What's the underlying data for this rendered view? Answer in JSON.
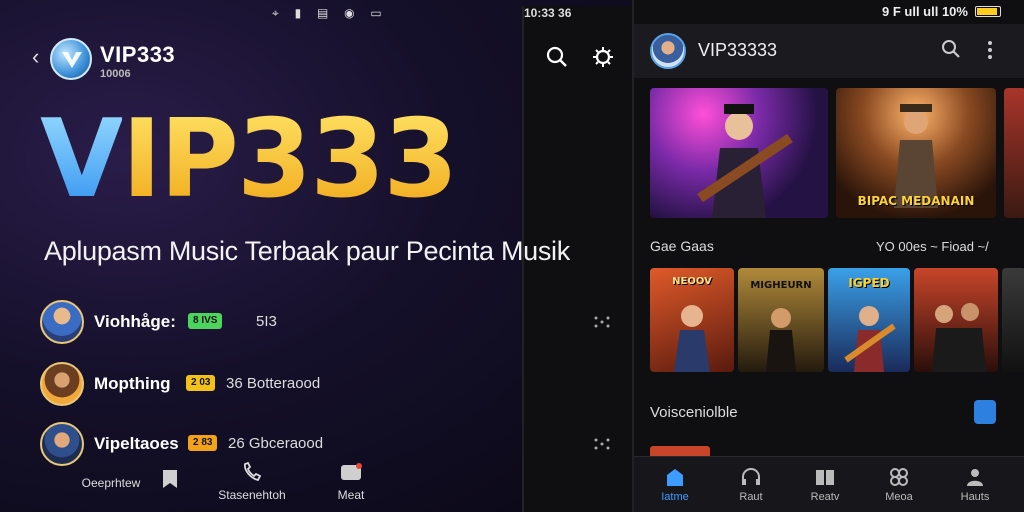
{
  "left": {
    "status": {
      "icons": "⌖ ▮ ▤ ◉ ▭",
      "right": "10:33 36"
    },
    "header": {
      "app_name": "VIP333",
      "app_sub": "10006"
    },
    "brand": {
      "v": "V",
      "rest": "IP333"
    },
    "tagline": "Aplupasm Music Terbaak paur Pecinta Musik",
    "users": [
      {
        "name": "Viohhåge:",
        "badge": "8 IVS",
        "badge_color": "#4cd45c",
        "meta": "5I3"
      },
      {
        "name": "Mopthing",
        "badge": "2 03",
        "badge_color": "#f2c21a",
        "meta": "36 Botteraood"
      },
      {
        "name": "Vipeltaoes",
        "badge": "2 83",
        "badge_color": "#f2a31a",
        "meta": "26 Gbceraood"
      }
    ],
    "bottom_nav": [
      {
        "label": "Oeeprhtew",
        "icon": "bookmark-icon"
      },
      {
        "label": "Stasenehtoh",
        "icon": "phone-icon"
      },
      {
        "label": "Meat",
        "icon": "chat-icon"
      }
    ]
  },
  "right": {
    "status": "9 F ull ull 10%",
    "topbar": {
      "title": "VIP33333"
    },
    "featured": [
      {
        "caption": "",
        "accent": "#c83fd0"
      },
      {
        "caption": "BIPAC MEDANAIN",
        "accent": "#d98a2c"
      }
    ],
    "section1": {
      "title": "Gae Gaas",
      "right": "YO 00es ~ Fioad ~/"
    },
    "grid": [
      {
        "caption": "NEOOV",
        "accent": "#e05a2a"
      },
      {
        "caption": "MIGHEURN",
        "accent": "#d9b54a"
      },
      {
        "caption": "IGPED",
        "accent": "#3aa0e8"
      },
      {
        "caption": "",
        "accent": "#c8452a"
      }
    ],
    "section2": {
      "title": "Voisceniolble"
    },
    "tabbar": [
      {
        "label": "Iatme",
        "icon": "home-icon",
        "active": true
      },
      {
        "label": "Raut",
        "icon": "headphones-icon",
        "active": false
      },
      {
        "label": "Reatv",
        "icon": "book-icon",
        "active": false
      },
      {
        "label": "Meoa",
        "icon": "grid-icon",
        "active": false
      },
      {
        "label": "Hauts",
        "icon": "user-icon",
        "active": false
      }
    ]
  }
}
